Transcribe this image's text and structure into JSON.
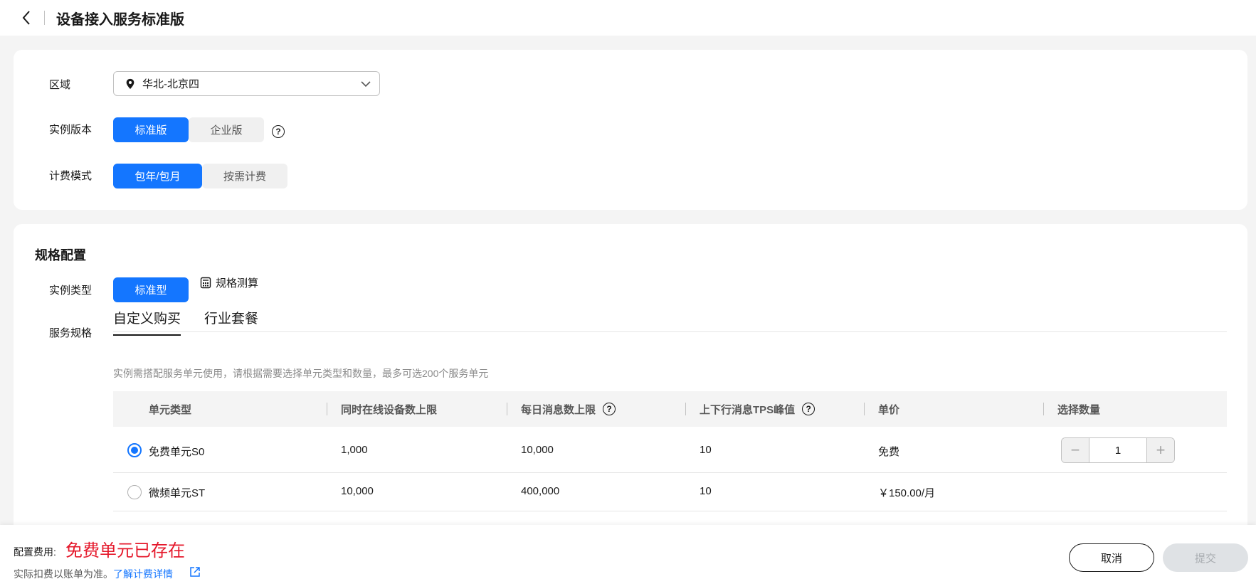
{
  "header": {
    "title": "设备接入服务标准版"
  },
  "basic": {
    "region_label": "区域",
    "region_value": "华北-北京四",
    "edition_label": "实例版本",
    "edition_options": [
      "标准版",
      "企业版"
    ],
    "billing_label": "计费模式",
    "billing_options": [
      "包年/包月",
      "按需计费"
    ]
  },
  "spec": {
    "title": "规格配置",
    "instance_type_label": "实例类型",
    "instance_type_option": "标准型",
    "calc_link": "规格测算",
    "service_spec_label": "服务规格",
    "tabs": [
      "自定义购买",
      "行业套餐"
    ],
    "hint": "实例需搭配服务单元使用，请根据需要选择单元类型和数量，最多可选200个服务单元",
    "table": {
      "headers": [
        "单元类型",
        "同时在线设备数上限",
        "每日消息数上限",
        "上下行消息TPS峰值",
        "单价",
        "选择数量"
      ],
      "rows": [
        {
          "type": "免费单元S0",
          "online": "1,000",
          "daily": "10,000",
          "tps": "10",
          "price": "免费",
          "qty": "1",
          "selected": true
        },
        {
          "type": "微频单元ST",
          "online": "10,000",
          "daily": "400,000",
          "tps": "10",
          "price": "￥150.00/月",
          "selected": false
        }
      ]
    }
  },
  "footer": {
    "fee_label": "配置费用:",
    "fee_value": "免费单元已存在",
    "note": "实际扣费以账单为准。",
    "link": "了解计费详情",
    "cancel": "取消",
    "submit": "提交"
  },
  "colors": {
    "primary": "#1476ff",
    "error": "#e5182b"
  }
}
